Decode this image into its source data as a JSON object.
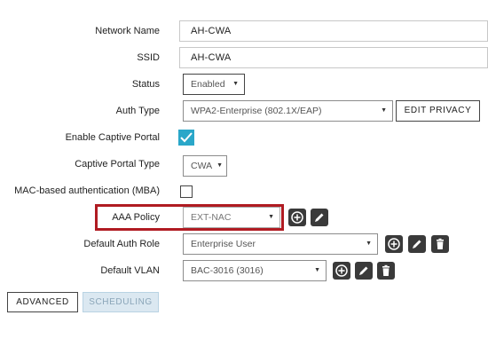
{
  "form": {
    "network_name": {
      "label": "Network Name",
      "value": "AH-CWA"
    },
    "ssid": {
      "label": "SSID",
      "value": "AH-CWA"
    },
    "status": {
      "label": "Status",
      "value": "Enabled"
    },
    "auth_type": {
      "label": "Auth Type",
      "value": "WPA2-Enterprise (802.1X/EAP)",
      "edit_button": "EDIT PRIVACY"
    },
    "captive_portal": {
      "label": "Enable Captive Portal",
      "checked": true
    },
    "captive_portal_type": {
      "label": "Captive Portal Type",
      "value": "CWA"
    },
    "mba": {
      "label": "MAC-based authentication (MBA)",
      "checked": false
    },
    "aaa_policy": {
      "label": "AAA Policy",
      "value": "EXT-NAC"
    },
    "default_auth_role": {
      "label": "Default Auth Role",
      "value": "Enterprise User"
    },
    "default_vlan": {
      "label": "Default VLAN",
      "value": "BAC-3016 (3016)"
    }
  },
  "tabs": {
    "advanced": "ADVANCED",
    "scheduling": "SCHEDULING"
  },
  "icons": {
    "add": "add-circle-icon",
    "edit": "pencil-icon",
    "delete": "trash-icon"
  },
  "colors": {
    "checkbox_checked": "#2aa7c9",
    "highlight": "#b01b22",
    "icon_button": "#3a3a3a"
  }
}
